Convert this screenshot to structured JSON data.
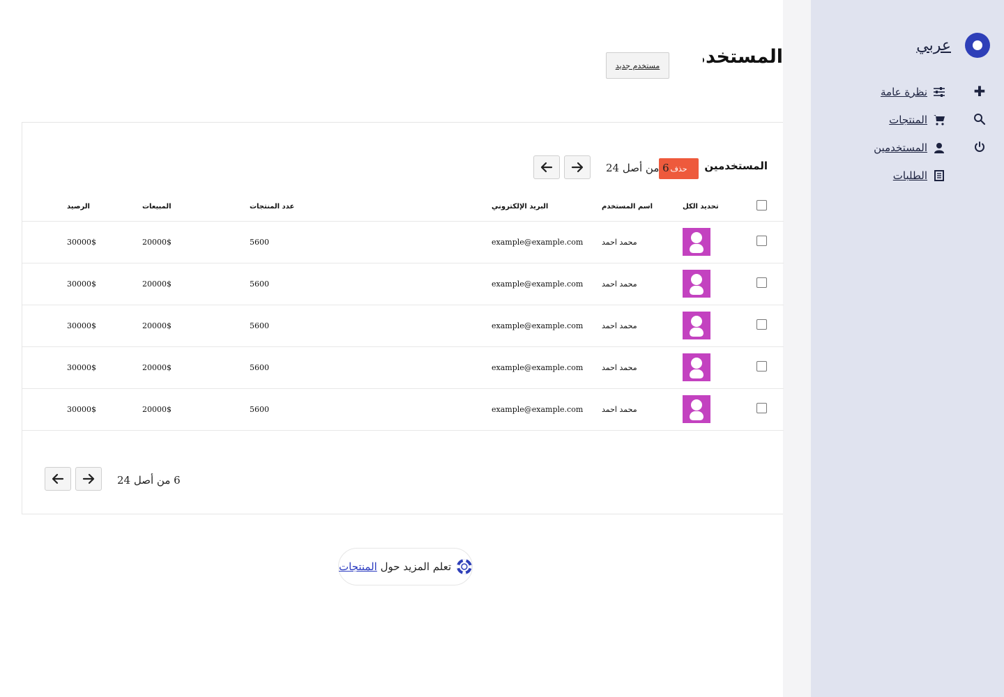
{
  "sidebar": {
    "brand": "عربي",
    "nav": [
      {
        "label": "نظرة عامة",
        "icon": "sliders-icon"
      },
      {
        "label": "المنتجات",
        "icon": "cart-icon"
      },
      {
        "label": "المستخدمين",
        "icon": "user-icon"
      },
      {
        "label": "الطلبات",
        "icon": "document-icon"
      }
    ],
    "side_icons": [
      "plus-icon",
      "search-icon",
      "power-icon"
    ]
  },
  "header": {
    "title": "المستخدمين",
    "new_user_label": "مستخدم جديد"
  },
  "card": {
    "title": "المستخدمين",
    "delete_label": "حذف",
    "pager_text": "6 من أصل 24",
    "columns": {
      "select_all": "تحديد الكل",
      "username": "اسم المستخدم",
      "email": "البريد الإلكتروني",
      "product_count": "عدد المنتجات",
      "sales": "المبيعات",
      "balance": "الرصيد"
    },
    "rows": [
      {
        "name": "محمد احمد",
        "email": "example@example.com",
        "product_count": "5600",
        "sales": "20000$",
        "balance": "30000$"
      },
      {
        "name": "محمد احمد",
        "email": "example@example.com",
        "product_count": "5600",
        "sales": "20000$",
        "balance": "30000$"
      },
      {
        "name": "محمد احمد",
        "email": "example@example.com",
        "product_count": "5600",
        "sales": "20000$",
        "balance": "30000$"
      },
      {
        "name": "محمد احمد",
        "email": "example@example.com",
        "product_count": "5600",
        "sales": "20000$",
        "balance": "30000$"
      },
      {
        "name": "محمد احمد",
        "email": "example@example.com",
        "product_count": "5600",
        "sales": "20000$",
        "balance": "30000$"
      }
    ],
    "pager_bottom_text": "6 من أصل 24"
  },
  "learn_more": {
    "prefix": "تعلم المزيد حول",
    "link": "المنتجات"
  },
  "colors": {
    "sidebar_bg": "#e0e3ef",
    "accent": "#2e3fb8",
    "delete": "#ee5a3c",
    "avatar": "#c342c0"
  }
}
